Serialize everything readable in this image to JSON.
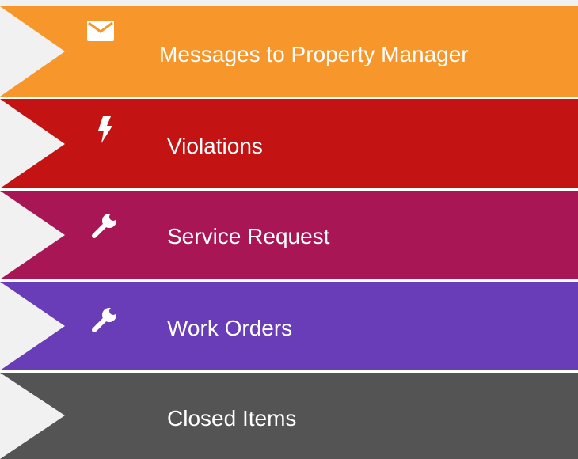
{
  "menu": {
    "items": [
      {
        "label": "Messages to Property Manager",
        "icon": "envelope-icon",
        "color": "#f7962a"
      },
      {
        "label": "Violations",
        "icon": "lightning-icon",
        "color": "#c31313"
      },
      {
        "label": "Service Request",
        "icon": "wrench-icon",
        "color": "#a91656"
      },
      {
        "label": "Work Orders",
        "icon": "wrench-icon",
        "color": "#6a3db8"
      },
      {
        "label": "Closed Items",
        "icon": "",
        "color": "#545454"
      }
    ]
  }
}
